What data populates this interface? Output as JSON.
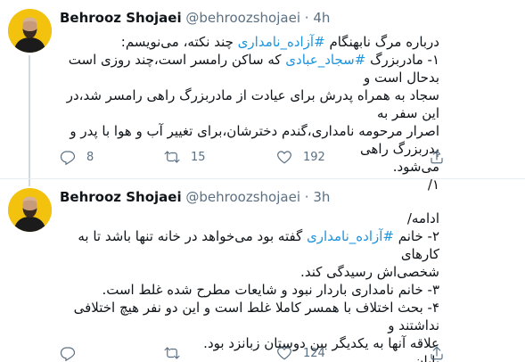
{
  "tweets": [
    {
      "author_name": "Behrooz Shojaei",
      "handle": "@behroozshojaei",
      "separator": "·",
      "time": "4h",
      "lines": [
        "درباره مرگ نابهنگام ",
        "۱- مادربزرگ ",
        "سجاد به همراه پدرش برای عیادت از مادربزرگ راهی رامسر شد،در این سفر به",
        "اصرار مرحومه نامداری،گندم دخترشان،برای تغییر آب و هوا با پدر و پدربزرگ راهی",
        "می‌شود.",
        "۱/"
      ],
      "line1_hashtag": "#آزاده_نامداری",
      "line1_rest": " چند نکته، می‌نویسم:",
      "line2_hashtag": "#سجاد_عبادی",
      "line2_rest": " که ساکن رامسر است،چند روزی است بدحال است و",
      "reply_count": "8",
      "retweet_count": "15",
      "like_count": "192",
      "icons": [
        "reply-icon",
        "retweet-icon",
        "like-icon",
        "share-icon"
      ]
    },
    {
      "author_name": "Behrooz Shojaei",
      "handle": "@behroozshojaei",
      "separator": "·",
      "time": "3h",
      "lines": [
        "ادامه/",
        "۲- خانم ",
        "شخصی‌اش رسیدگی کند.",
        "۳- خانم نامداری باردار نبود و شایعات مطرح شده غلط است.",
        "۴- بحث اختلاف با همسر کاملا غلط است و این دو نفر هیچ اختلافی نداشتند و",
        "علاقه آنها به یکدیگر بین دوستان زبانزد بود.",
        "پایان"
      ],
      "line2_hashtag": "#آزاده_نامداری",
      "line2_rest": " گفته بود می‌خواهد در خانه تنها باشد تا به کارهای",
      "reply_count": "",
      "retweet_count": "",
      "like_count": "124",
      "icons": [
        "reply-icon",
        "retweet-icon",
        "like-icon",
        "share-icon"
      ]
    }
  ],
  "colors": {
    "hashtag": "#1b95e0",
    "muted": "#5b7083",
    "avatar_bg": "#f3c413"
  }
}
